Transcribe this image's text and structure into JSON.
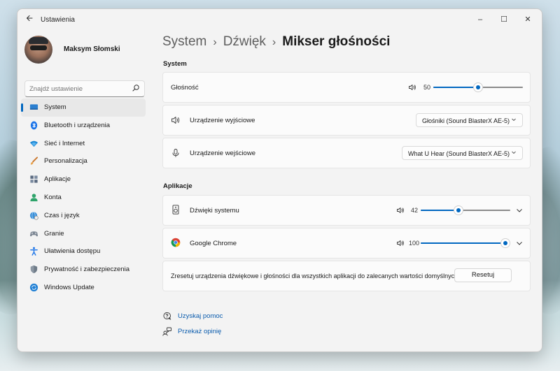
{
  "window": {
    "app_title": "Ustawienia",
    "back_icon": "back-arrow-icon",
    "minimize_label": "–",
    "maximize_label": "☐",
    "close_label": "✕"
  },
  "profile": {
    "name": "Maksym Słomski"
  },
  "search": {
    "placeholder": "Znajdź ustawienie",
    "value": ""
  },
  "nav": [
    {
      "label": "System",
      "icon": "display-icon",
      "active": true
    },
    {
      "label": "Bluetooth i urządzenia",
      "icon": "bluetooth-icon"
    },
    {
      "label": "Sieć i Internet",
      "icon": "wifi-icon"
    },
    {
      "label": "Personalizacja",
      "icon": "brush-icon"
    },
    {
      "label": "Aplikacje",
      "icon": "apps-icon"
    },
    {
      "label": "Konta",
      "icon": "person-icon"
    },
    {
      "label": "Czas i język",
      "icon": "globe-clock-icon"
    },
    {
      "label": "Granie",
      "icon": "gamepad-icon"
    },
    {
      "label": "Ułatwienia dostępu",
      "icon": "accessibility-icon"
    },
    {
      "label": "Prywatność i zabezpieczenia",
      "icon": "shield-icon"
    },
    {
      "label": "Windows Update",
      "icon": "update-icon"
    }
  ],
  "breadcrumb": {
    "level1": "System",
    "level2": "Dźwięk",
    "current": "Mikser głośności",
    "separator": "›"
  },
  "system_section": {
    "title": "System",
    "volume": {
      "label": "Głośność",
      "value": "50",
      "level": 50
    },
    "output": {
      "label": "Urządzenie wyjściowe",
      "selected": "Głośniki (Sound BlasterX AE-5)"
    },
    "input": {
      "label": "Urządzenie wejściowe",
      "selected": "What U Hear (Sound BlasterX AE-5)"
    }
  },
  "apps_section": {
    "title": "Aplikacje",
    "apps": [
      {
        "label": "Dźwięki systemu",
        "value": "42",
        "level": 42,
        "icon": "speaker-device-icon"
      },
      {
        "label": "Google Chrome",
        "value": "100",
        "level": 100,
        "icon": "chrome-icon"
      }
    ],
    "reset_text": "Zresetuj urządzenia dźwiękowe i głośności dla wszystkich aplikacji do zalecanych wartości domyślnych",
    "reset_button": "Resetuj"
  },
  "help": {
    "get_help": "Uzyskaj pomoc",
    "feedback": "Przekaż opinię"
  },
  "colors": {
    "accent": "#0067c0",
    "link": "#0b5cad"
  }
}
